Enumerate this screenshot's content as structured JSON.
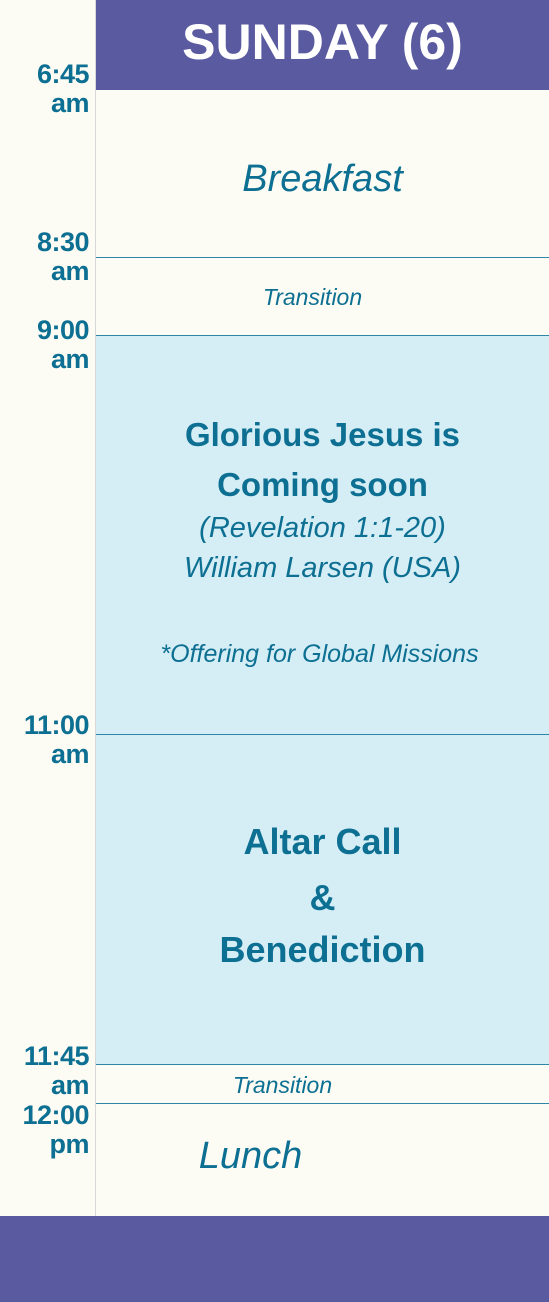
{
  "header": {
    "title": "SUNDAY (6)"
  },
  "times": [
    {
      "h": "6:45",
      "p": "am"
    },
    {
      "h": "8:30",
      "p": "am"
    },
    {
      "h": "9:00",
      "p": "am"
    },
    {
      "h": "11:00",
      "p": "am"
    },
    {
      "h": "11:45",
      "p": "am"
    },
    {
      "h": "12:00",
      "p": "pm"
    }
  ],
  "events": {
    "breakfast": "Breakfast",
    "transition1": "Transition",
    "session": {
      "title_line1": "Glorious Jesus is",
      "title_line2": "Coming soon",
      "scripture": "(Revelation 1:1-20)",
      "speaker": "William Larsen (USA)",
      "note": "*Offering for Global Missions"
    },
    "altar": {
      "line1": "Altar Call",
      "line2": "&",
      "line3": "Benediction"
    },
    "transition2": "Transition",
    "lunch": "Lunch"
  },
  "colors": {
    "header_bg": "#5a5aa0",
    "accent_text": "#0d6f92",
    "session_bg": "#d5eef6",
    "page_bg": "#fcfcf5"
  }
}
